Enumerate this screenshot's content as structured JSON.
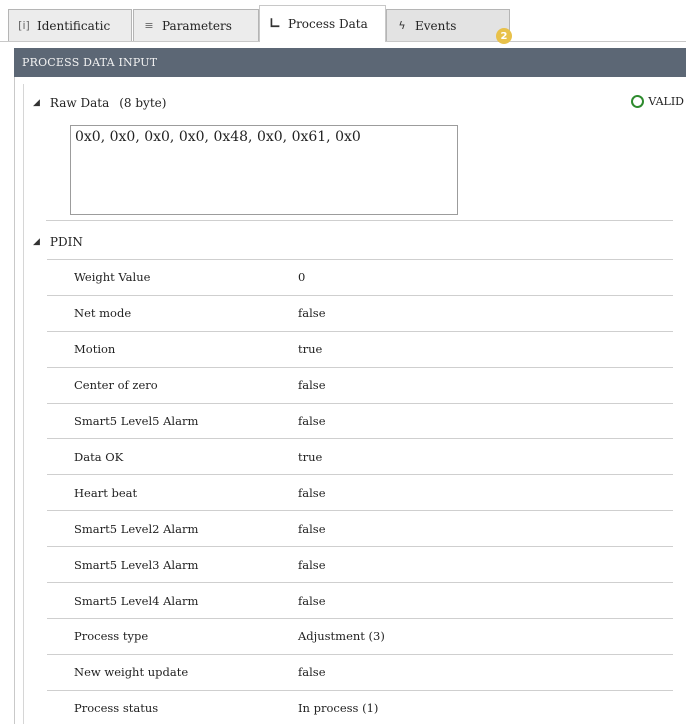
{
  "tabs": [
    {
      "label": "Identificatic",
      "icon": "id-card-icon",
      "glyph": "[i]"
    },
    {
      "label": "Parameters",
      "icon": "list-icon",
      "glyph": "≡"
    },
    {
      "label": "Process Data",
      "icon": "chart-axis-icon",
      "glyph": "∟"
    },
    {
      "label": "Events",
      "icon": "lightning-icon",
      "glyph": "ϟ"
    }
  ],
  "events_badge": "2",
  "header": {
    "title": "PROCESS DATA INPUT"
  },
  "raw_data": {
    "label": "Raw Data",
    "size": "(8 byte)",
    "value": "0x0, 0x0, 0x0, 0x0, 0x48, 0x0, 0x61, 0x0",
    "status": "VALID"
  },
  "pdin": {
    "label": "PDIN",
    "rows": [
      {
        "name": "Weight Value",
        "value": "0"
      },
      {
        "name": "Net mode",
        "value": "false"
      },
      {
        "name": "Motion",
        "value": "true"
      },
      {
        "name": "Center of zero",
        "value": "false"
      },
      {
        "name": "Smart5 Level5 Alarm",
        "value": "false"
      },
      {
        "name": "Data OK",
        "value": "true"
      },
      {
        "name": "Heart beat",
        "value": "false"
      },
      {
        "name": "Smart5 Level2 Alarm",
        "value": "false"
      },
      {
        "name": "Smart5 Level3 Alarm",
        "value": "false"
      },
      {
        "name": "Smart5 Level4 Alarm",
        "value": "false"
      },
      {
        "name": "Process type",
        "value": "Adjustment (3)"
      },
      {
        "name": "New weight update",
        "value": "false"
      },
      {
        "name": "Process status",
        "value": "In process (1)"
      }
    ]
  },
  "colors": {
    "header_bg": "#5c6775",
    "valid_green": "#2e8b2e",
    "badge": "#e8c14a"
  }
}
